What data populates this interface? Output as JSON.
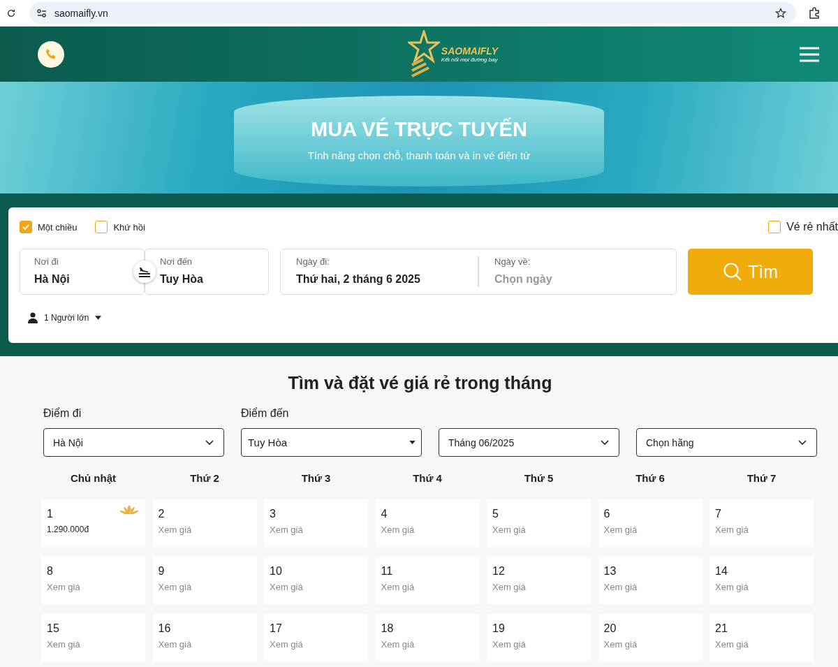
{
  "browser": {
    "url": "saomaifly.vn"
  },
  "header": {
    "logo": {
      "name": "SAOMAIFLY",
      "tagline": "Kết nối mọi đường bay"
    }
  },
  "hero": {
    "title": "MUA VÉ TRỰC TUYẾN",
    "subtitle": "Tính năng chọn chỗ, thanh toán và in vé điện tử"
  },
  "search": {
    "trip_types": [
      {
        "label": "Một chiều",
        "selected": true
      },
      {
        "label": "Khứ hồi",
        "selected": false
      }
    ],
    "cheapest": {
      "label": "Vé rẻ nhất",
      "checked": false
    },
    "from": {
      "label": "Nơi đi",
      "value": "Hà Nội"
    },
    "to": {
      "label": "Nơi đến",
      "value": "Tuy Hòa"
    },
    "depart": {
      "label": "Ngày đi:",
      "value": "Thứ hai, 2 tháng 6 2025"
    },
    "return": {
      "label": "Ngày về:",
      "placeholder": "Chọn ngày"
    },
    "search_button": "Tìm",
    "passengers": "1 Người lớn"
  },
  "monthly": {
    "title": "Tìm và đặt vé giá rẻ trong tháng",
    "filters": [
      {
        "label": "Điểm đi",
        "value": "Hà Nội",
        "kind": "chevron"
      },
      {
        "label": "Điểm đến",
        "value": "Tuy Hòa",
        "kind": "caret"
      },
      {
        "value": "Tháng 06/2025",
        "kind": "chevron"
      },
      {
        "value": "Chọn hãng",
        "kind": "chevron"
      }
    ],
    "weekdays": [
      "Chủ nhật",
      "Thứ 2",
      "Thứ 3",
      "Thứ 4",
      "Thứ 5",
      "Thứ 6",
      "Thứ 7"
    ],
    "days": [
      {
        "day": "1",
        "price": "1.290.000đ",
        "kind": "price",
        "airline_logo": true
      },
      {
        "day": "2",
        "price": "Xem giá",
        "kind": "view",
        "airline_logo": false
      },
      {
        "day": "3",
        "price": "Xem giá",
        "kind": "view",
        "airline_logo": false
      },
      {
        "day": "4",
        "price": "Xem giá",
        "kind": "view",
        "airline_logo": false
      },
      {
        "day": "5",
        "price": "Xem giá",
        "kind": "view",
        "airline_logo": false
      },
      {
        "day": "6",
        "price": "Xem giá",
        "kind": "view",
        "airline_logo": false
      },
      {
        "day": "7",
        "price": "Xem giá",
        "kind": "view",
        "airline_logo": false
      },
      {
        "day": "8",
        "price": "Xem giá",
        "kind": "view",
        "airline_logo": false
      },
      {
        "day": "9",
        "price": "Xem giá",
        "kind": "view",
        "airline_logo": false
      },
      {
        "day": "10",
        "price": "Xem giá",
        "kind": "view",
        "airline_logo": false
      },
      {
        "day": "11",
        "price": "Xem giá",
        "kind": "view",
        "airline_logo": false
      },
      {
        "day": "12",
        "price": "Xem giá",
        "kind": "view",
        "airline_logo": false
      },
      {
        "day": "13",
        "price": "Xem giá",
        "kind": "view",
        "airline_logo": false
      },
      {
        "day": "14",
        "price": "Xem giá",
        "kind": "view",
        "airline_logo": false
      },
      {
        "day": "15",
        "price": "Xem giá",
        "kind": "view",
        "airline_logo": false
      },
      {
        "day": "16",
        "price": "Xem giá",
        "kind": "view",
        "airline_logo": false
      },
      {
        "day": "17",
        "price": "Xem giá",
        "kind": "view",
        "airline_logo": false
      },
      {
        "day": "18",
        "price": "Xem giá",
        "kind": "view",
        "airline_logo": false
      },
      {
        "day": "19",
        "price": "Xem giá",
        "kind": "view",
        "airline_logo": false
      },
      {
        "day": "20",
        "price": "Xem giá",
        "kind": "view",
        "airline_logo": false
      },
      {
        "day": "21",
        "price": "Xem giá",
        "kind": "view",
        "airline_logo": false
      }
    ]
  }
}
